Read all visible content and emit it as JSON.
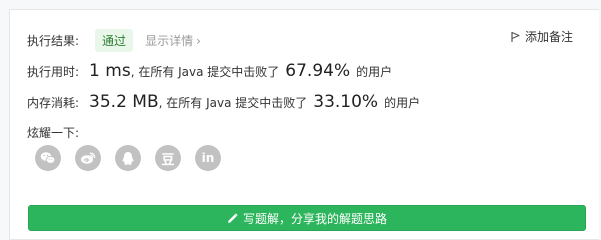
{
  "result": {
    "label": "执行结果:",
    "status": "通过",
    "detail_link": "显示详情",
    "add_note": "添加备注"
  },
  "runtime": {
    "label": "执行用时:",
    "value": "1 ms",
    "prefix": ", 在所有 Java 提交中击败了",
    "percent": "67.94%",
    "suffix": "的用户"
  },
  "memory": {
    "label": "内存消耗:",
    "value": "35.2 MB",
    "prefix": ", 在所有 Java 提交中击败了",
    "percent": "33.10%",
    "suffix": "的用户"
  },
  "share": {
    "title": "炫耀一下:",
    "icons": [
      "wechat-icon",
      "weibo-icon",
      "qq-icon",
      "douban-icon",
      "linkedin-icon"
    ],
    "douban_glyph": "豆",
    "linkedin_glyph": "in"
  },
  "cta": {
    "label": "写题解，分享我的解题思路"
  },
  "colors": {
    "accent_green": "#2db55d",
    "badge_bg": "#e9f6ea",
    "badge_text": "#2e7d32",
    "icon_gray": "#c2c2c2"
  }
}
